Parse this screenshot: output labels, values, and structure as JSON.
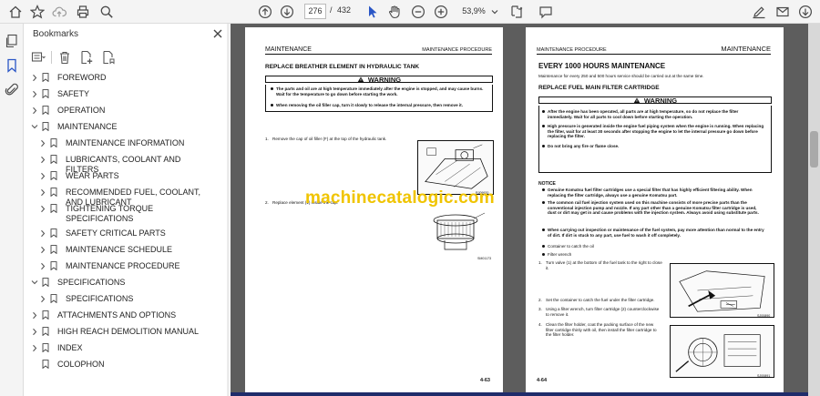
{
  "toolbar": {
    "current_page": "276",
    "page_separator": "/",
    "total_pages": "432",
    "zoom": "53,9%"
  },
  "sidebar": {
    "title": "Bookmarks",
    "items": [
      {
        "label": "FOREWORD",
        "level": 0,
        "expandable": true,
        "expanded": false
      },
      {
        "label": "SAFETY",
        "level": 0,
        "expandable": true,
        "expanded": false
      },
      {
        "label": "OPERATION",
        "level": 0,
        "expandable": true,
        "expanded": false
      },
      {
        "label": "MAINTENANCE",
        "level": 0,
        "expandable": true,
        "expanded": true
      },
      {
        "label": "MAINTENANCE INFORMATION",
        "level": 1,
        "expandable": true,
        "expanded": false
      },
      {
        "label": "LUBRICANTS, COOLANT AND FILTERS",
        "level": 1,
        "expandable": true,
        "expanded": false
      },
      {
        "label": "WEAR PARTS",
        "level": 1,
        "expandable": true,
        "expanded": false
      },
      {
        "label": "RECOMMENDED FUEL, COOLANT, AND LUBRICANT",
        "level": 1,
        "expandable": true,
        "expanded": false
      },
      {
        "label": "TIGHTENING TORQUE SPECIFICATIONS",
        "level": 1,
        "expandable": true,
        "expanded": false
      },
      {
        "label": "SAFETY CRITICAL PARTS",
        "level": 1,
        "expandable": true,
        "expanded": false
      },
      {
        "label": "MAINTENANCE SCHEDULE",
        "level": 1,
        "expandable": true,
        "expanded": false
      },
      {
        "label": "MAINTENANCE PROCEDURE",
        "level": 1,
        "expandable": true,
        "expanded": false
      },
      {
        "label": "SPECIFICATIONS",
        "level": 0,
        "expandable": true,
        "expanded": true
      },
      {
        "label": "SPECIFICATIONS",
        "level": 1,
        "expandable": true,
        "expanded": false
      },
      {
        "label": "ATTACHMENTS AND OPTIONS",
        "level": 0,
        "expandable": true,
        "expanded": false
      },
      {
        "label": "HIGH REACH DEMOLITION MANUAL",
        "level": 0,
        "expandable": true,
        "expanded": false
      },
      {
        "label": "INDEX",
        "level": 0,
        "expandable": true,
        "expanded": false
      },
      {
        "label": "COLOPHON",
        "level": 0,
        "expandable": false,
        "expanded": false
      }
    ]
  },
  "left_page": {
    "header_left": "MAINTENANCE",
    "header_right": "MAINTENANCE PROCEDURE",
    "section_title": "REPLACE BREATHER ELEMENT IN HYDRAULIC TANK",
    "warning_label": "WARNING",
    "warnings": [
      "The parts and oil are at high temperature immediately after the engine is stopped, and may cause burns. Wait for the temperature to go down before starting the work.",
      "When removing the oil filler cap, turn it slowly to release the internal pressure, then remove it."
    ],
    "steps": [
      "Remove the cap of oil filler (F) at the top of the hydraulic tank.",
      "Replace element (1) inside the cap."
    ],
    "fig1_code": "RJ09920",
    "fig2_code": "SM01173",
    "page_number": "4-63"
  },
  "right_page": {
    "header_left": "MAINTENANCE PROCEDURE",
    "header_right": "MAINTENANCE",
    "section_title": "EVERY 1000 HOURS MAINTENANCE",
    "intro": "Maintenance for every 250 and 500 hours service should be carried out at the same time.",
    "subsection_title": "REPLACE FUEL MAIN FILTER CARTRIDGE",
    "warning_label": "WARNING",
    "warnings": [
      "After the engine has been operated, all parts are at high temperature, so do not replace the filter immediately. Wait for all parts to cool down before starting the operation.",
      "High pressure is generated inside the engine fuel piping system when the engine is running. When replacing the filter, wait for at least 30 seconds after stopping the engine to let the internal pressure go down before replacing the filter.",
      "Do not bring any fire or flame close."
    ],
    "notice_label": "NOTICE",
    "notices": [
      "Genuine Komatsu fuel filter cartridges use a special filter that has highly efficient filtering ability. When replacing the filter cartridge, always use a genuine Komatsu part.",
      "The common rail fuel injection system used on this machine consists of more precise parts than the conventional injection pump and nozzle. If any part other than a genuine Komatsu filter cartridge is used, dust or dirt may get in and cause problems with the injection system. Always avoid using substitute parts.",
      "When carrying out inspection or maintenance of the fuel system, pay more attention than normal to the entry of dirt. If dirt is stuck to any part, use fuel to wash it off completely."
    ],
    "tools": [
      "Container to catch the oil",
      "Filter wrench"
    ],
    "steps": [
      "Turn valve (1) at the bottom of the fuel tank to the right to close it.",
      "Set the container to catch the fuel under the filter cartridge.",
      "Using a filter wrench, turn filter cartridge (2) counterclockwise to remove it.",
      "Clean the filter holder, coat the packing surface of the new filter cartridge thinly with oil, then install the filter cartridge to the filter holder."
    ],
    "fig1_code": "SJ00890",
    "fig2_code": "SJ00891",
    "page_number": "4-64"
  },
  "watermark": "machinecatalogic.com"
}
